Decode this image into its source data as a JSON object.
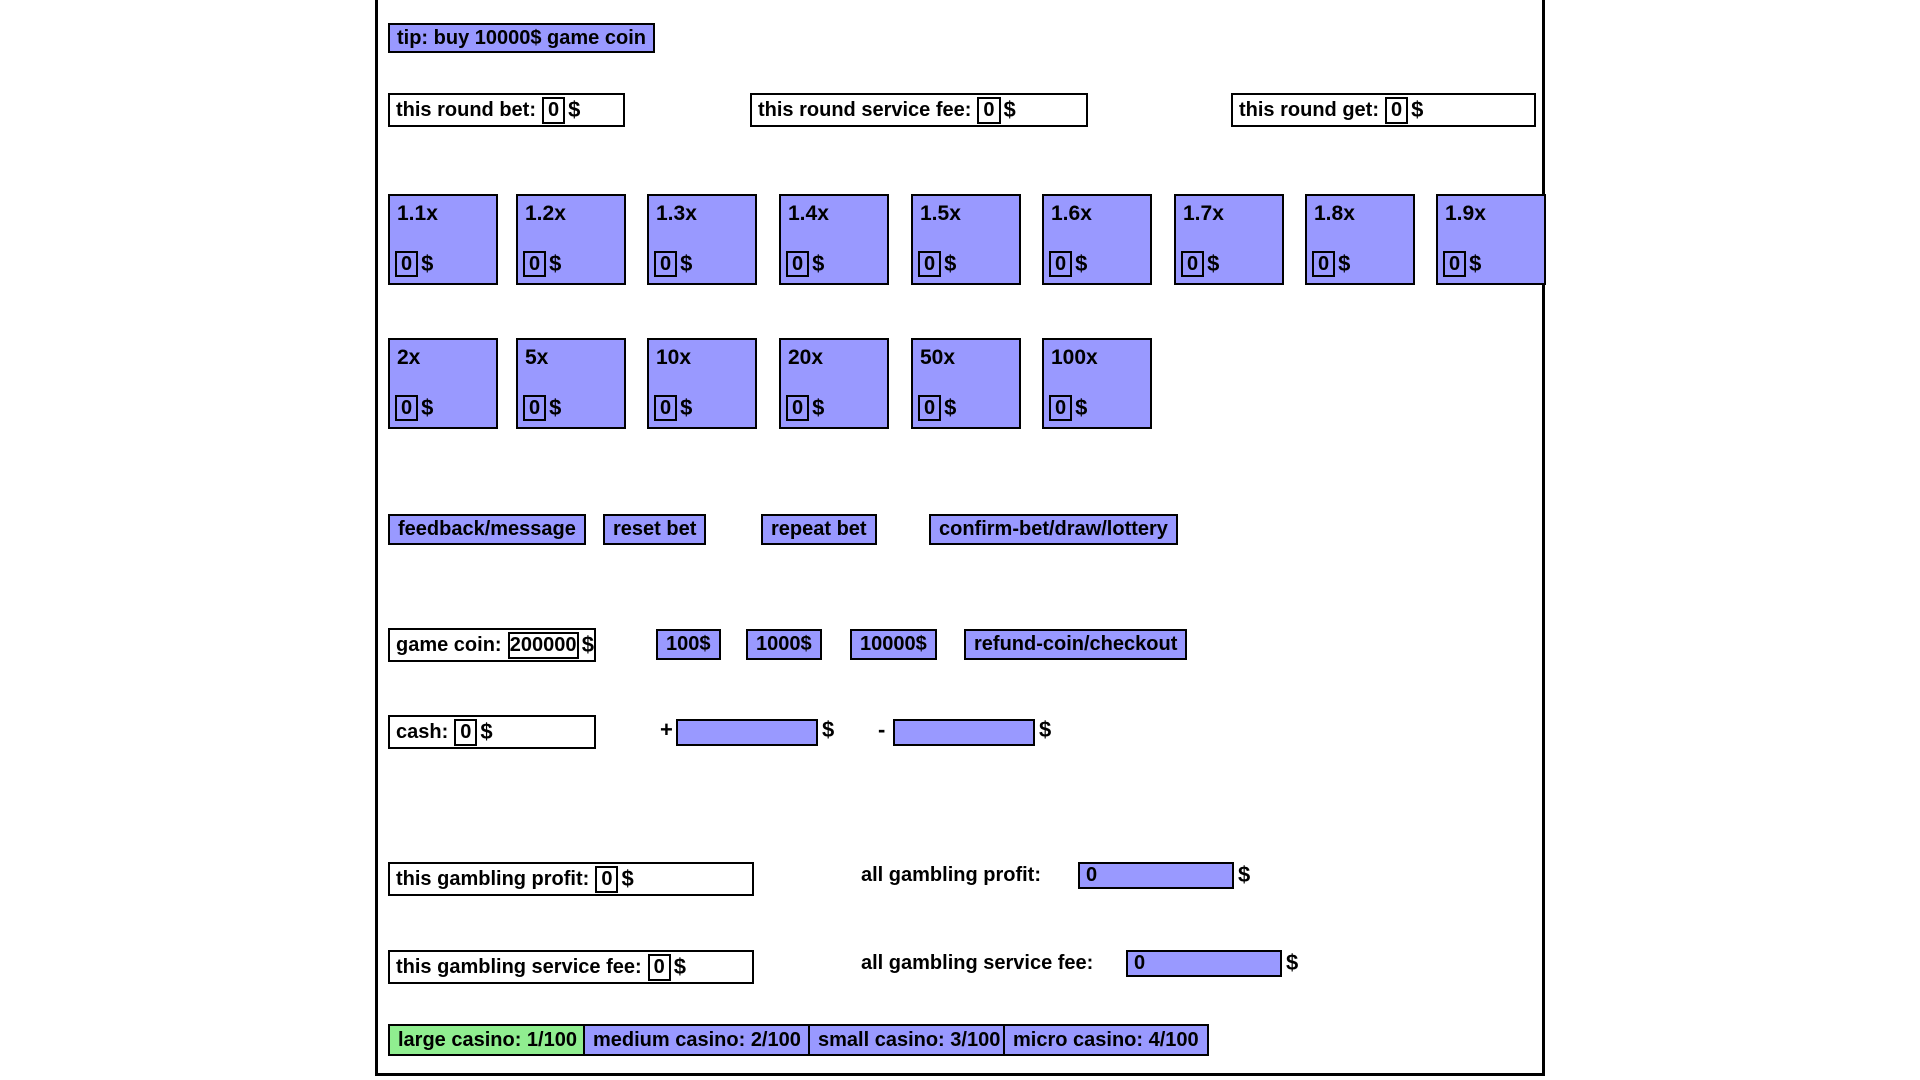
{
  "tip": {
    "text": "tip: buy 10000$ game coin"
  },
  "round": {
    "bet": {
      "label": "this round bet:",
      "value": "0",
      "unit": "$"
    },
    "service_fee": {
      "label": "this round service fee:",
      "value": "0",
      "unit": "$"
    },
    "get": {
      "label": "this round get:",
      "value": "0",
      "unit": "$"
    }
  },
  "multipliers_row1": [
    {
      "label": "1.1x",
      "value": "0",
      "unit": "$"
    },
    {
      "label": "1.2x",
      "value": "0",
      "unit": "$"
    },
    {
      "label": "1.3x",
      "value": "0",
      "unit": "$"
    },
    {
      "label": "1.4x",
      "value": "0",
      "unit": "$"
    },
    {
      "label": "1.5x",
      "value": "0",
      "unit": "$"
    },
    {
      "label": "1.6x",
      "value": "0",
      "unit": "$"
    },
    {
      "label": "1.7x",
      "value": "0",
      "unit": "$"
    },
    {
      "label": "1.8x",
      "value": "0",
      "unit": "$"
    },
    {
      "label": "1.9x",
      "value": "0",
      "unit": "$"
    }
  ],
  "multipliers_row2": [
    {
      "label": "2x",
      "value": "0",
      "unit": "$"
    },
    {
      "label": "5x",
      "value": "0",
      "unit": "$"
    },
    {
      "label": "10x",
      "value": "0",
      "unit": "$"
    },
    {
      "label": "20x",
      "value": "0",
      "unit": "$"
    },
    {
      "label": "50x",
      "value": "0",
      "unit": "$"
    },
    {
      "label": "100x",
      "value": "0",
      "unit": "$"
    }
  ],
  "actions": {
    "feedback": "feedback/message",
    "reset_bet": "reset bet",
    "repeat_bet": "repeat bet",
    "confirm": "confirm-bet/draw/lottery"
  },
  "wallet": {
    "game_coin": {
      "label": "game coin:",
      "value": "200000",
      "unit": "$"
    },
    "buy_100": "100$",
    "buy_1000": "1000$",
    "buy_10000": "10000$",
    "refund": "refund-coin/checkout",
    "cash": {
      "label": "cash:",
      "value": "0",
      "unit": "$"
    },
    "plus_sign": "+",
    "plus_value": "",
    "plus_unit": "$",
    "minus_sign": "-",
    "minus_value": "",
    "minus_unit": "$"
  },
  "stats": {
    "this_profit": {
      "label": "this gambling profit:",
      "value": "0",
      "unit": "$"
    },
    "all_profit": {
      "label": "all gambling profit:",
      "value": "0",
      "unit": "$"
    },
    "this_service_fee": {
      "label": "this gambling service fee:",
      "value": "0",
      "unit": "$"
    },
    "all_service_fee": {
      "label": "all gambling service fee:",
      "value": "0",
      "unit": "$"
    }
  },
  "casinos": [
    {
      "label": "large casino: 1/100",
      "selected": true
    },
    {
      "label": "medium casino: 2/100",
      "selected": false
    },
    {
      "label": "small casino: 3/100",
      "selected": false
    },
    {
      "label": "micro casino: 4/100",
      "selected": false
    }
  ],
  "colors": {
    "widget": "#9999ff",
    "selected": "#90ee90",
    "border": "#000000",
    "background": "#ffffff"
  }
}
